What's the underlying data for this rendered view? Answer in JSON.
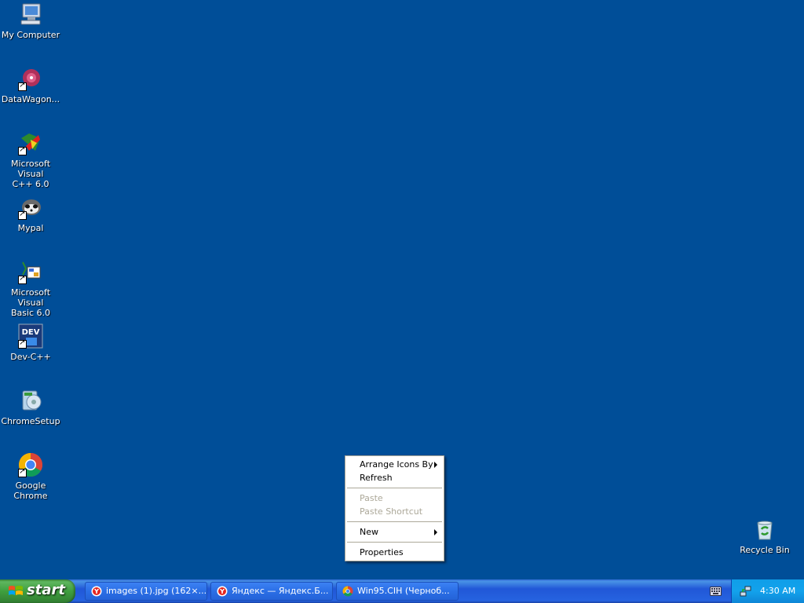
{
  "desktop": {
    "icons": [
      {
        "label": "My Computer",
        "icon": "computer-icon"
      },
      {
        "label": "DataWagon...",
        "icon": "datawagon-icon"
      },
      {
        "label": "Microsoft Visual\nC++ 6.0",
        "icon": "visual-cpp-icon"
      },
      {
        "label": "Mypal",
        "icon": "mypal-icon"
      },
      {
        "label": "Microsoft Visual\nBasic 6.0",
        "icon": "visual-basic-icon"
      },
      {
        "label": "Dev-C++",
        "icon": "dev-cpp-icon"
      },
      {
        "label": "ChromeSetup",
        "icon": "chrome-setup-icon"
      },
      {
        "label": "Google Chrome",
        "icon": "chrome-icon"
      },
      {
        "label": "Recycle Bin",
        "icon": "recycle-bin-icon"
      }
    ]
  },
  "context_menu": {
    "items": [
      {
        "label": "Arrange Icons By",
        "submenu": true,
        "disabled": false
      },
      {
        "label": "Refresh",
        "submenu": false,
        "disabled": false
      },
      {
        "label": "Paste",
        "submenu": false,
        "disabled": true
      },
      {
        "label": "Paste Shortcut",
        "submenu": false,
        "disabled": true
      },
      {
        "label": "New",
        "submenu": true,
        "disabled": false
      },
      {
        "label": "Properties",
        "submenu": false,
        "disabled": false
      }
    ]
  },
  "taskbar": {
    "start_label": "start",
    "tasks": [
      {
        "label": "images (1).jpg (162×...",
        "icon": "yandex-browser-icon"
      },
      {
        "label": "Яндекс — Яндекс.Б...",
        "icon": "yandex-browser-icon"
      },
      {
        "label": "Win95.CIH (Черноб...",
        "icon": "chrome-icon"
      }
    ],
    "clock": "4:30 AM"
  },
  "colors": {
    "desktop_bg": "#004e98",
    "taskbar_blue": "#2157d7",
    "start_green": "#3f9f3f",
    "tray_blue": "#13a2ec"
  }
}
